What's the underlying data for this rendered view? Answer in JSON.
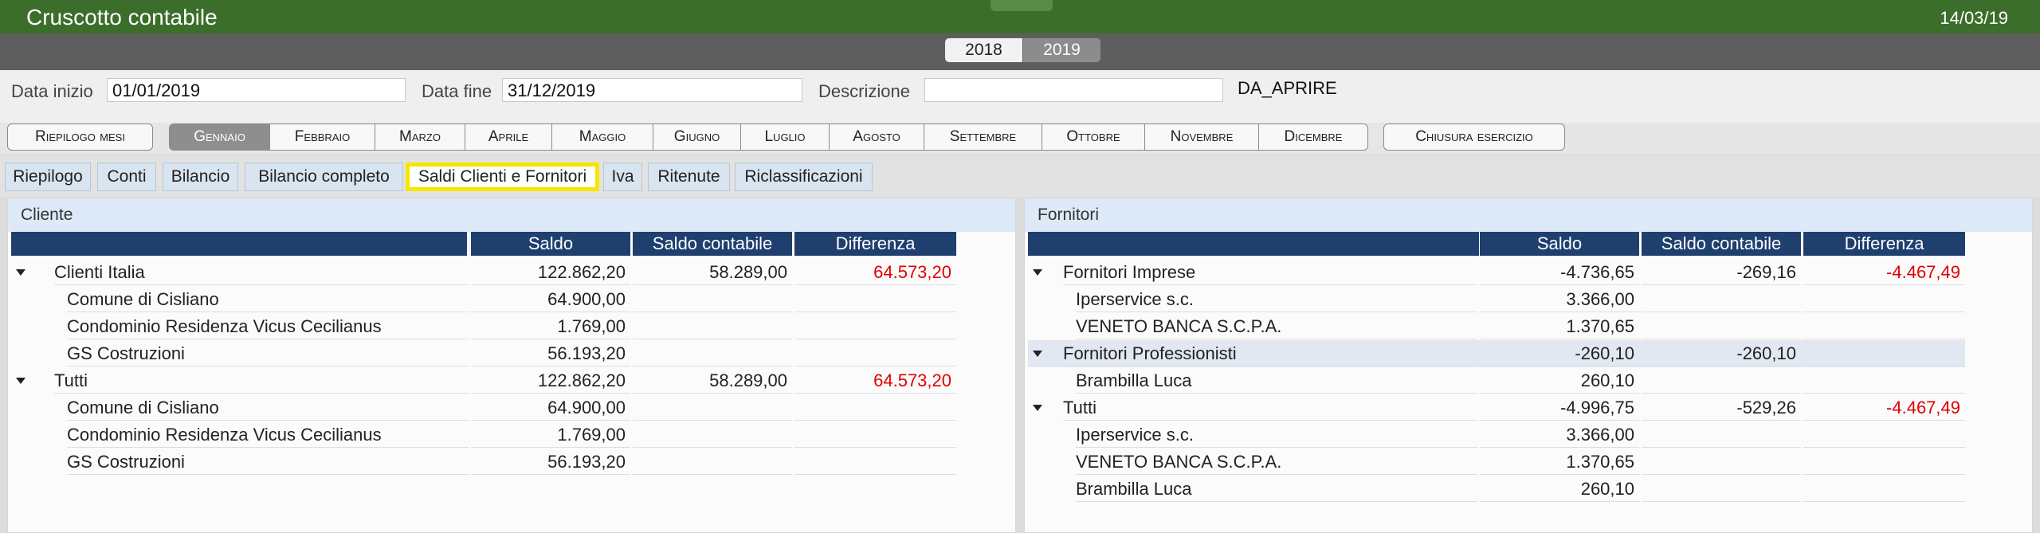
{
  "app": {
    "title": "Cruscotto contabile",
    "date": "14/03/19"
  },
  "years": [
    "2018",
    "2019"
  ],
  "filters": {
    "data_inizio_label": "Data inizio",
    "data_inizio_value": "01/01/2019",
    "data_fine_label": "Data fine",
    "data_fine_value": "31/12/2019",
    "descrizione_label": "Descrizione",
    "descrizione_value": "",
    "descrizione_static": "DA_APRIRE"
  },
  "months": {
    "riepilogo": "Riepilogo mesi",
    "items": [
      "Gennaio",
      "Febbraio",
      "Marzo",
      "Aprile",
      "Maggio",
      "Giugno",
      "Luglio",
      "Agosto",
      "Settembre",
      "Ottobre",
      "Novembre",
      "Dicembre"
    ],
    "active": "Gennaio",
    "chiusura": "Chiusura esercizio"
  },
  "tabs": [
    "Riepilogo",
    "Conti",
    "Bilancio",
    "Bilancio completo",
    "Saldi Clienti e Fornitori",
    "Iva",
    "Ritenute",
    "Riclassificazioni"
  ],
  "active_tab": "Saldi Clienti e Fornitori",
  "clienti": {
    "title": "Cliente",
    "columns": [
      "Saldo",
      "Saldo contabile",
      "Differenza"
    ],
    "rows": [
      {
        "label": "Clienti Italia",
        "saldo": "122.862,20",
        "saldo_contabile": "58.289,00",
        "differenza": "64.573,20",
        "group": true
      },
      {
        "label": "Comune di Cisliano",
        "saldo": "64.900,00",
        "saldo_contabile": "",
        "differenza": "",
        "group": false
      },
      {
        "label": "Condominio Residenza Vicus Cecilianus",
        "saldo": "1.769,00",
        "saldo_contabile": "",
        "differenza": "",
        "group": false
      },
      {
        "label": "GS Costruzioni",
        "saldo": "56.193,20",
        "saldo_contabile": "",
        "differenza": "",
        "group": false
      },
      {
        "label": "Tutti",
        "saldo": "122.862,20",
        "saldo_contabile": "58.289,00",
        "differenza": "64.573,20",
        "group": true
      },
      {
        "label": "Comune di Cisliano",
        "saldo": "64.900,00",
        "saldo_contabile": "",
        "differenza": "",
        "group": false
      },
      {
        "label": "Condominio Residenza Vicus Cecilianus",
        "saldo": "1.769,00",
        "saldo_contabile": "",
        "differenza": "",
        "group": false
      },
      {
        "label": "GS Costruzioni",
        "saldo": "56.193,20",
        "saldo_contabile": "",
        "differenza": "",
        "group": false
      }
    ]
  },
  "fornitori": {
    "title": "Fornitori",
    "columns": [
      "Saldo",
      "Saldo contabile",
      "Differenza"
    ],
    "rows": [
      {
        "label": "Fornitori Imprese",
        "saldo": "-4.736,65",
        "saldo_contabile": "-269,16",
        "differenza": "-4.467,49",
        "group": true
      },
      {
        "label": "Iperservice s.c.",
        "saldo": "3.366,00",
        "saldo_contabile": "",
        "differenza": "",
        "group": false
      },
      {
        "label": "VENETO BANCA S.C.P.A.",
        "saldo": "1.370,65",
        "saldo_contabile": "",
        "differenza": "",
        "group": false
      },
      {
        "label": "Fornitori Professionisti",
        "saldo": "-260,10",
        "saldo_contabile": "-260,10",
        "differenza": "",
        "group": true,
        "selected": true
      },
      {
        "label": "Brambilla Luca",
        "saldo": "260,10",
        "saldo_contabile": "",
        "differenza": "",
        "group": false
      },
      {
        "label": "Tutti",
        "saldo": "-4.996,75",
        "saldo_contabile": "-529,26",
        "differenza": "-4.467,49",
        "group": true
      },
      {
        "label": "Iperservice s.c.",
        "saldo": "3.366,00",
        "saldo_contabile": "",
        "differenza": "",
        "group": false
      },
      {
        "label": "VENETO BANCA S.C.P.A.",
        "saldo": "1.370,65",
        "saldo_contabile": "",
        "differenza": "",
        "group": false
      },
      {
        "label": "Brambilla Luca",
        "saldo": "260,10",
        "saldo_contabile": "",
        "differenza": "",
        "group": false
      }
    ]
  },
  "colors": {
    "titlebar": "#3c6e2b",
    "header": "#1f3f6f",
    "negative": "#e00000",
    "highlight": "#f5e600"
  }
}
